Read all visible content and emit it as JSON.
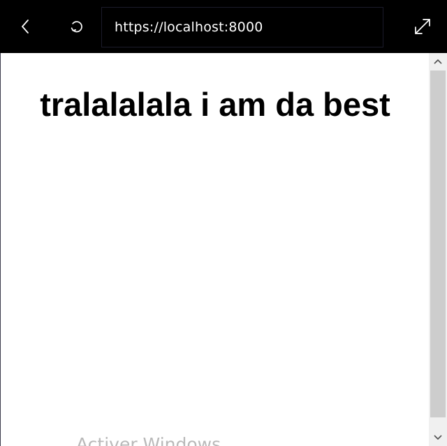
{
  "toolbar": {
    "back_icon": "chevron-left-icon",
    "reload_icon": "reload-icon",
    "expand_icon": "expand-icon",
    "address": "https://localhost:8000",
    "background_color": "#000000",
    "text_color": "#ffffff"
  },
  "page": {
    "heading": "tralalalala i am da best"
  },
  "scrollbar": {
    "up_icon": "chevron-up-icon",
    "down_icon": "chevron-down-icon"
  },
  "watermark": {
    "text": "Activer Windows"
  }
}
